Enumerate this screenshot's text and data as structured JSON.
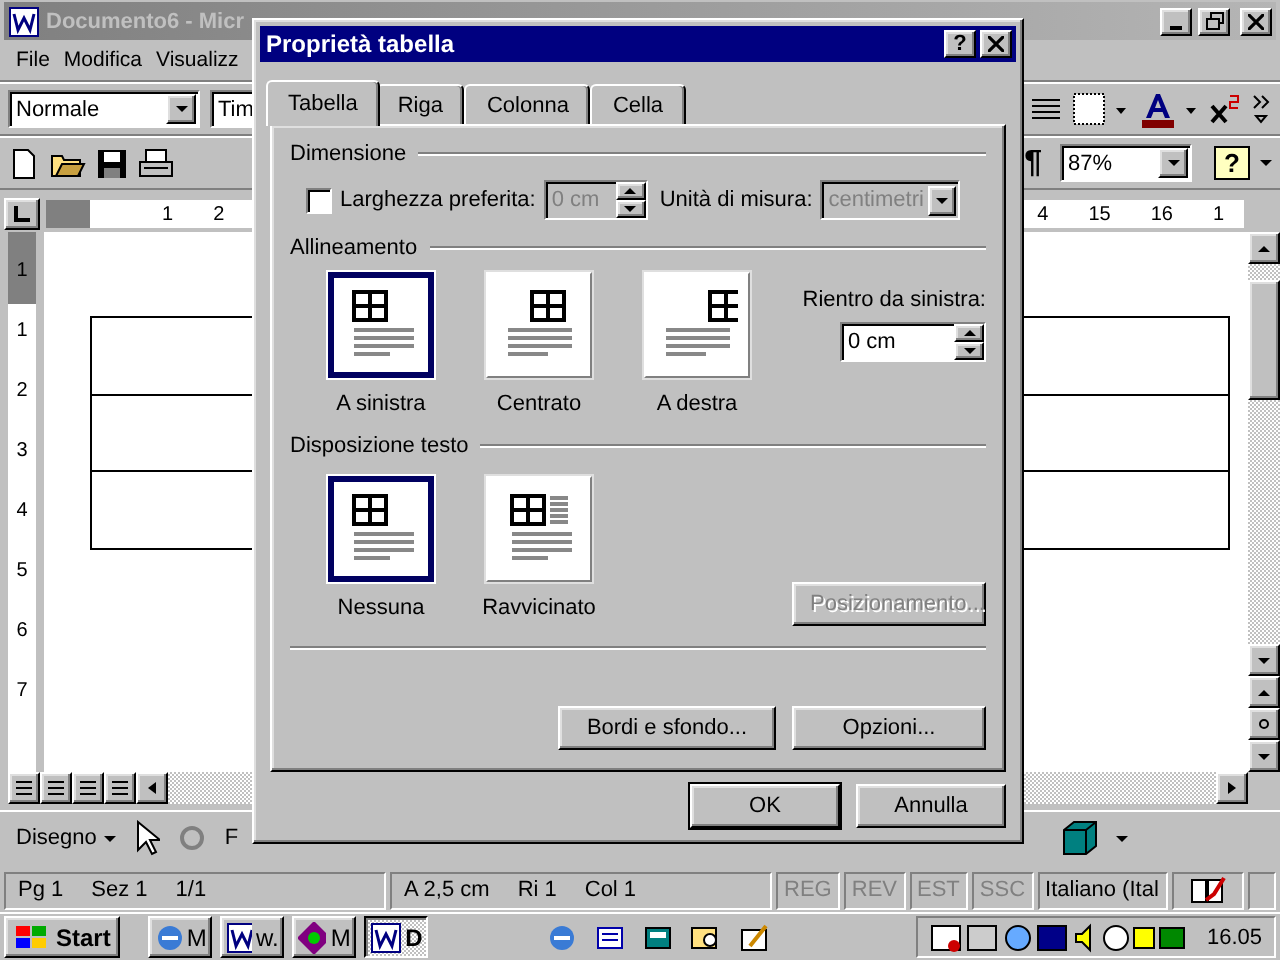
{
  "word_window": {
    "title": "Documento6 - Micr",
    "menu": [
      "File",
      "Modifica",
      "Visualizz"
    ],
    "toolbar": {
      "style": "Normale",
      "font": "Tim",
      "pilcrow": "¶",
      "zoom": "87%",
      "help": "?"
    },
    "ruler": {
      "left_numbers": [
        "1",
        "2"
      ],
      "right_numbers": [
        "4",
        "15",
        "16",
        "1"
      ],
      "vertical_numbers": [
        "1",
        "1",
        "2",
        "3",
        "4",
        "5",
        "6",
        "7"
      ]
    },
    "drawing_toolbar": {
      "menu": "Disegno",
      "cut_label": "F"
    },
    "status_bar": {
      "groups": [
        [
          "Pg 1",
          "Sez 1",
          "1/1"
        ],
        [
          "A 2,5 cm",
          "Ri 1",
          "Col 1"
        ]
      ],
      "modes": [
        {
          "label": "REG",
          "active": false
        },
        {
          "label": "REV",
          "active": false
        },
        {
          "label": "EST",
          "active": false
        },
        {
          "label": "SSC",
          "active": false
        }
      ],
      "language": "Italiano (Ital"
    }
  },
  "dialog": {
    "title": "Proprietà tabella",
    "help": "?",
    "tabs": [
      {
        "label": "Tabella",
        "selected": true
      },
      {
        "label": "Riga",
        "selected": false
      },
      {
        "label": "Colonna",
        "selected": false
      },
      {
        "label": "Cella",
        "selected": false
      }
    ],
    "dimension": {
      "heading": "Dimensione",
      "preferred_width": {
        "label": "Larghezza preferita:",
        "checked": false
      },
      "width_value": "0 cm",
      "unit_label": "Unità di misura:",
      "unit_value": "centimetri",
      "disabled": true
    },
    "alignment": {
      "heading": "Allineamento",
      "options": [
        {
          "label": "A sinistra",
          "kind": "left",
          "selected": true
        },
        {
          "label": "Centrato",
          "kind": "center",
          "selected": false
        },
        {
          "label": "A destra",
          "kind": "right",
          "selected": false
        }
      ],
      "indent_label": "Rientro da sinistra:",
      "indent_value": "0 cm"
    },
    "wrapping": {
      "heading": "Disposizione testo",
      "options": [
        {
          "label": "Nessuna",
          "kind": "none",
          "selected": true
        },
        {
          "label": "Ravvicinato",
          "kind": "around",
          "selected": false
        }
      ],
      "positioning": {
        "label": "Posizionamento...",
        "disabled": true
      }
    },
    "panel_buttons": [
      "Bordi e sfondo...",
      "Opzioni..."
    ],
    "buttons": [
      {
        "label": "OK",
        "default": true
      },
      {
        "label": "Annulla",
        "default": false
      }
    ]
  },
  "taskbar": {
    "start": "Start",
    "tasks": [
      {
        "label": "M",
        "kind": "browser",
        "selected": false
      },
      {
        "label": "w.",
        "kind": "word",
        "selected": false
      },
      {
        "label": "M",
        "kind": "paint",
        "selected": false
      },
      {
        "label": "D",
        "kind": "word",
        "selected": true
      }
    ],
    "clock": "16.05"
  }
}
